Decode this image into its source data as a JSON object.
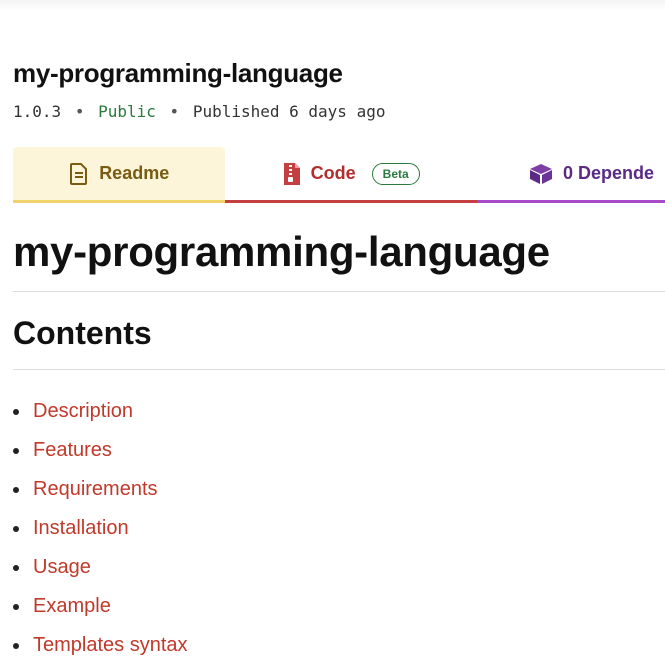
{
  "package": {
    "name": "my-programming-language",
    "version": "1.0.3",
    "visibility": "Public",
    "published": "Published 6 days ago",
    "separator": "•"
  },
  "tabs": [
    {
      "label": "Readme",
      "icon": "file-text-icon",
      "color": "#7a5b14",
      "active": true
    },
    {
      "label": "Code",
      "icon": "zip-file-icon",
      "badge": "Beta",
      "color": "#b32d2d"
    },
    {
      "label": "0 Depende",
      "icon": "cube-icon",
      "color": "#5b2a86"
    }
  ],
  "readme": {
    "heading": "my-programming-language",
    "contents_heading": "Contents",
    "toc": [
      "Description",
      "Features",
      "Requirements",
      "Installation",
      "Usage",
      "Example",
      "Templates syntax"
    ]
  },
  "colors": {
    "link": "#c0392b",
    "public": "#2b7a3d",
    "readme_tab_bg": "#fcf5d9"
  }
}
